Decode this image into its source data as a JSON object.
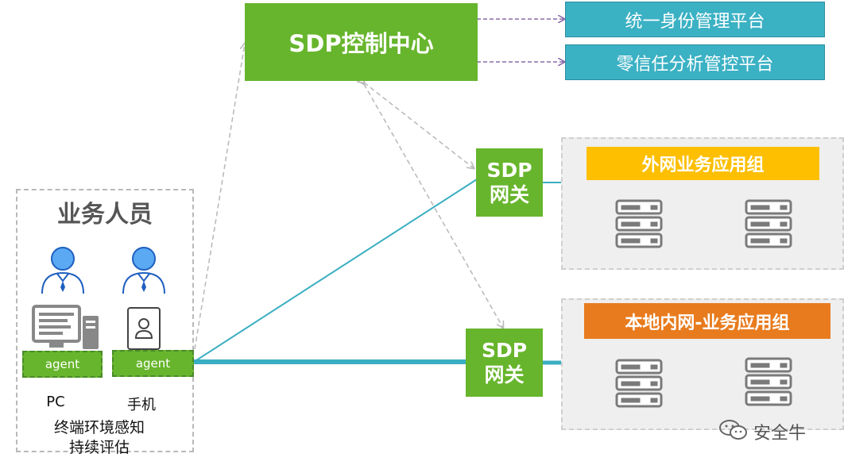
{
  "control_center": {
    "label": "SDP控制中心"
  },
  "platforms": [
    {
      "label": "统一身份管理平台"
    },
    {
      "label": "零信任分析管控平台"
    }
  ],
  "gateways": [
    {
      "line1": "SDP",
      "line2": "网关"
    },
    {
      "line1": "SDP",
      "line2": "网关"
    }
  ],
  "app_groups": [
    {
      "title": "外网业务应用组",
      "color": "#fdbf00"
    },
    {
      "title": "本地内网-业务应用组",
      "color": "#e87b1e"
    }
  ],
  "users": {
    "title": "业务人员",
    "agent_pc": "agent",
    "agent_phone": "agent",
    "pc_label": "PC",
    "phone_label": "手机",
    "note_line1": "终端环境感知",
    "note_line2": "持续评估"
  },
  "watermark": {
    "text": "安全牛",
    "icon": "wechat-icon"
  },
  "colors": {
    "green": "#67b52c",
    "teal": "#3bb1c4",
    "link_line": "#3aaec2",
    "dashed_arrow": "#bbbbbb",
    "purple_arrow": "#8a6aa8"
  }
}
